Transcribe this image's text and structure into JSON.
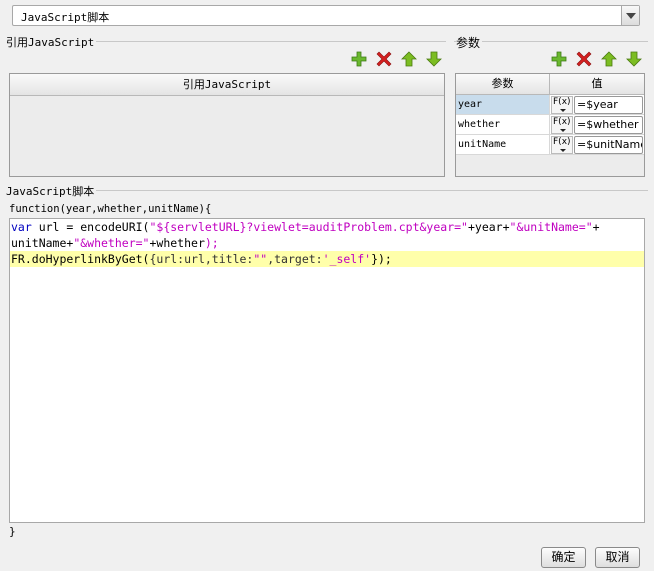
{
  "script_type_select": {
    "value": "JavaScript脚本"
  },
  "ref_section": {
    "title": "引用JavaScript",
    "column_header": "引用JavaScript"
  },
  "param_section": {
    "title": "参数",
    "col_param": "参数",
    "col_value": "值",
    "rows": [
      {
        "name": "year",
        "fx": "F(x)",
        "value": "=$year"
      },
      {
        "name": "whether",
        "fx": "F(x)",
        "value": "=$whether"
      },
      {
        "name": "unitName",
        "fx": "F(x)",
        "value": "=$unitName"
      }
    ]
  },
  "script_section": {
    "title": "JavaScript脚本",
    "signature": "function(year,whether,unitName){",
    "closing": "}",
    "code": {
      "l1_kw": "var",
      "l1_mid": " url = encodeURI(",
      "l1_str1": "\"${servletURL}?viewlet=auditProblem.cpt&year=\"",
      "l1_plus1": "+year+",
      "l1_str2": "\"&unitName=\"",
      "l1_plus2": "+",
      "l2_a": "unitName+",
      "l2_str": "\"&whether=\"",
      "l2_b": "+whether",
      "l2_c": ");",
      "l3_a": "FR.doHyperlinkByGet(",
      "l3_b": "{url:url,title:",
      "l3_str1": "\"\"",
      "l3_c": ",target:",
      "l3_str2": "'_self'",
      "l3_d": "});"
    }
  },
  "buttons": {
    "ok": "确定",
    "cancel": "取消"
  },
  "colors": {
    "add": "#6ab82e",
    "remove": "#d42020",
    "move": "#7cbd22",
    "highlight": "#ffffaa",
    "keyword": "#0000c0",
    "string": "#c000c0"
  }
}
